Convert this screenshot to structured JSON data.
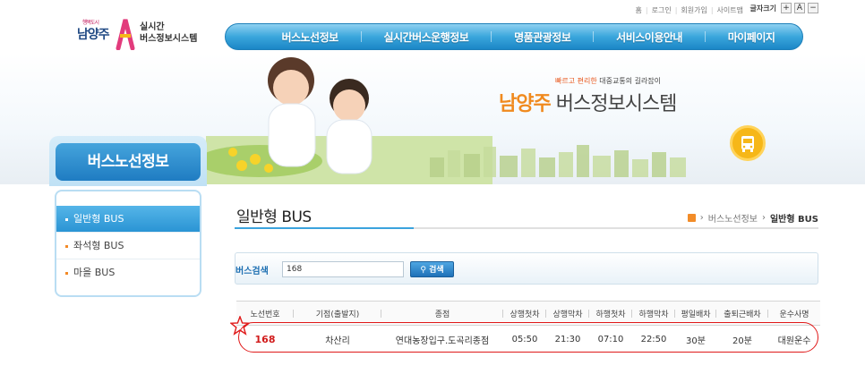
{
  "utility": {
    "links": [
      "홈",
      "로그인",
      "회원가입",
      "사이트맵"
    ],
    "font_size_label": "글자크기",
    "font_plus": "+",
    "font_reset": "A",
    "font_minus": "−"
  },
  "logo": {
    "slogan_small": "행복도시",
    "city": "남양주",
    "line1": "실시간",
    "line2": "버스정보시스템"
  },
  "nav": {
    "items": [
      "버스노선정보",
      "실시간버스운행정보",
      "명품관광정보",
      "서비스이용안내",
      "마이페이지"
    ]
  },
  "banner": {
    "tagline_highlight": "빠르고 편리한",
    "tagline_rest": " 대중교통의 길라잡이",
    "city_name": "남양주",
    "system_name": " 버스정보시스템"
  },
  "side": {
    "title": "버스노선정보",
    "items": [
      "일반형 BUS",
      "좌석형 BUS",
      "마을 BUS"
    ]
  },
  "page": {
    "title": "일반형 BUS",
    "breadcrumb": [
      "버스노선정보",
      "일반형 BUS"
    ]
  },
  "search": {
    "label": "버스검색",
    "value": "168",
    "button": "검색"
  },
  "table": {
    "headers": [
      "노선번호",
      "기점(출발지)",
      "종점",
      "상행첫차",
      "상행막차",
      "하행첫차",
      "하행막차",
      "평일배차",
      "출퇴근배차",
      "운수사명"
    ],
    "rows": [
      [
        "168",
        "차산리",
        "연대농장입구.도곡리종점",
        "05:50",
        "21:30",
        "07:10",
        "22:50",
        "30분",
        "20분",
        "대원운수"
      ]
    ]
  },
  "colors": {
    "nav_blue": "#2a94d4",
    "accent_orange": "#f08a1e",
    "highlight_red": "#e01919"
  }
}
